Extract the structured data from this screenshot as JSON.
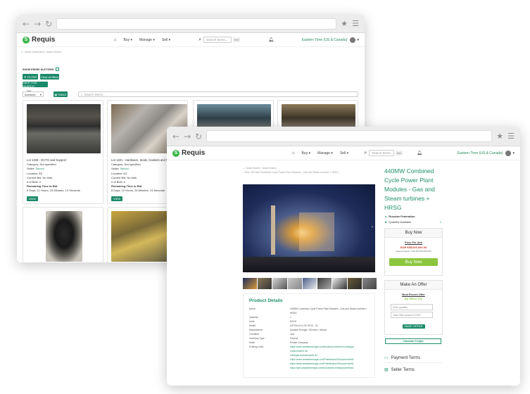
{
  "back_window": {
    "brand": "Requis",
    "nav": [
      "Buy ▾",
      "Manage ▾",
      "Sell ▾"
    ],
    "search_placeholder": "Search Items...",
    "search_btn": "»»»",
    "timezone": "Eastern Time (US & Canada)",
    "breadcrumb": "›  Asset Distribution  ›  Asset Search",
    "show_ended": "SHOW ENDED AUCTIONS",
    "filter_btn": "▼ FILTER",
    "clear_btn": "Clear all filters",
    "save_btn": "SAVE THIS SEARCH",
    "view_label": "View",
    "view_value": "Auctions",
    "table_btn": "▦ TABLE",
    "filter_placeholder": "Search Items...",
    "cards": [
      {
        "title": "Lot 1208 - OCTG and Support",
        "category": "Category: Not specified",
        "seller_label": "Seller:",
        "seller": "Samco",
        "location": "Location: AZ",
        "bid": "Current Bid: No bids",
        "bids": "# of Bids: 0",
        "remaining": "Remaining Time to Bid",
        "time": "8 Days, 11 Hours, 24 Minutes, 13 Seconds",
        "button": "VIEW"
      },
      {
        "title": "Lot 1201 - Hardware, Seals, Gaskets and Misc",
        "category": "Category: Not specified",
        "seller_label": "Seller:",
        "seller": "Samco",
        "location": "Location: AZ",
        "bid": "Current Bid: No bids",
        "bids": "# of Bids: 0",
        "remaining": "Remaining Time to Bid",
        "time": "8 Days, 10 Hours, 24 Minutes, 13 Seconds",
        "button": "VIEW"
      }
    ]
  },
  "front_window": {
    "brand": "Requis",
    "nav": [
      "Buy ▾",
      "Manage ▾",
      "Sell ▾"
    ],
    "search_placeholder": "Search Items...",
    "search_btn": "»»»",
    "timezone": "Eastern Time (US & Canada)",
    "breadcrumb1": "›  Asset Search  ›  Asset Search",
    "breadcrumb2": "›  View: 440 MW Combined Cycle Power Plant Modules - Gas and Steam turbines + HRSG",
    "title": "440MW Combined Cycle Power Plant Modules - Gas and Steam turbines + HRSG",
    "location": "Russian Federation",
    "quantity_label": "Quantity Available",
    "quantity": "1",
    "buy_now": "Buy Now",
    "price_label": "Price Per Unit",
    "price": "EUR €55,000,000.00",
    "approx": "(approximately: CAD $78,554,560.00)",
    "buy_button": "Buy Now",
    "offer_title": "Make An Offer",
    "recent_offer": "Most Recent Offer",
    "no_offers": "No Offers Yet!",
    "qty_placeholder": "Enter quantity",
    "total_placeholder": "Total Offer Amount in EUR",
    "make_offer": "MAKE OFFER",
    "freight": "Calculate Freight",
    "payment_terms": "Payment Terms",
    "seller_terms": "Seller Terms",
    "details_title": "Product Details",
    "details": [
      {
        "k": "Name",
        "v": "440MW Combined Cycle Power Plant Modules - Gas and Steam turbines + HRSG"
      },
      {
        "k": "Quantity",
        "v": "1"
      },
      {
        "k": "Units",
        "v": "EACH"
      },
      {
        "k": "Model",
        "v": "GE7FA.04 & GE 9F.03 - 02"
      },
      {
        "k": "Manufacturer",
        "v": "Ansaldo Energia / Siemens / Alstom"
      },
      {
        "k": "Condition",
        "v": "new"
      },
      {
        "k": "Inventory Type",
        "v": "Surplus"
      },
      {
        "k": "Seller",
        "v": "Private Company"
      },
      {
        "k": "Existing Links",
        "v": "https://www.ansaldoenergia.com/business-lines/new-units/gas-turbines/ae94.3a"
      }
    ],
    "links": [
      "units/gas-turbines/ae94.3a",
      "https://www.ansaldoenergia.com/Pubblicazioni/Documents/AE",
      "https://www.ansaldoenergia.com/Pubblicazioni/Documents/AE",
      "https://self.ansaldoenergia.com/en/turbines-energia/combined"
    ]
  }
}
